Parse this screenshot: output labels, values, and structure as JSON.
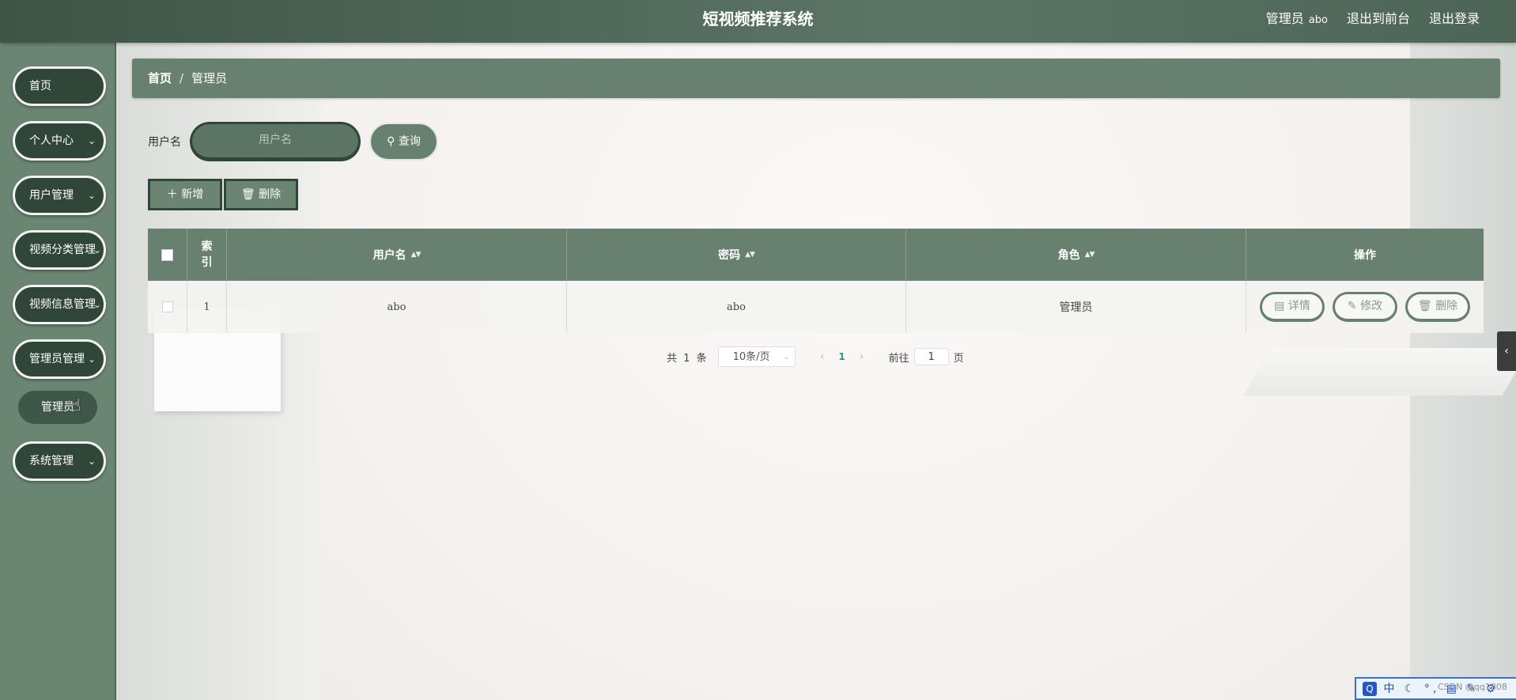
{
  "header": {
    "title": "短视频推荐系统",
    "role_label": "管理员",
    "user_name": "abo",
    "back_to_front": "退出到前台",
    "logout": "退出登录"
  },
  "sidebar": {
    "items": [
      {
        "label": "首页"
      },
      {
        "label": "个人中心"
      },
      {
        "label": "用户管理"
      },
      {
        "label": "视频分类管理"
      },
      {
        "label": "视频信息管理"
      },
      {
        "label": "管理员管理"
      },
      {
        "label": "系统管理"
      }
    ],
    "submenu": {
      "label": "管理员"
    }
  },
  "breadcrumb": {
    "home": "首页",
    "separator": "/",
    "current": "管理员"
  },
  "search": {
    "label": "用户名",
    "placeholder": "用户名",
    "button": "查询",
    "button_icon": "search-icon"
  },
  "actions": {
    "add": "新增",
    "delete": "删除"
  },
  "table": {
    "headers": {
      "index": "索引",
      "username": "用户名",
      "password": "密码",
      "role": "角色",
      "ops": "操作"
    },
    "rows": [
      {
        "index": "1",
        "username": "abo",
        "password": "abo",
        "role": "管理员"
      }
    ],
    "row_actions": {
      "detail": "详情",
      "edit": "修改",
      "delete": "删除"
    }
  },
  "pagination": {
    "total_prefix": "共",
    "total": "1",
    "total_suffix": "条",
    "page_size": "10条/页",
    "current_page": "1",
    "goto_label": "前往",
    "goto_value": "1",
    "goto_suffix": "页"
  },
  "ime": {
    "text": "中 ☾ °, ▤ ✎ ⚙"
  },
  "watermark": "CSDN @qq1808",
  "colors": {
    "accent": "#67806f",
    "dark": "#2f4638",
    "topbar": "#4c6556"
  }
}
